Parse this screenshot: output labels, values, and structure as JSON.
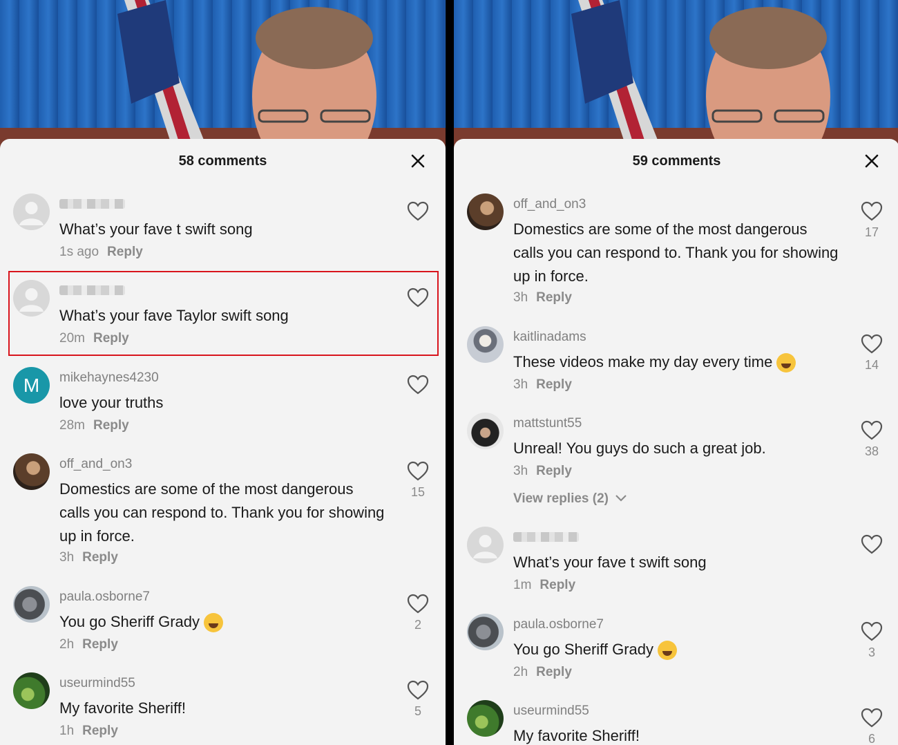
{
  "left": {
    "title": "58 comments",
    "comments": [
      {
        "username": "",
        "text": "What’s your fave t swift song",
        "time": "1s ago",
        "reply": "Reply",
        "likes": ""
      },
      {
        "username": "",
        "text": "What’s your fave Taylor swift song",
        "time": "20m",
        "reply": "Reply",
        "likes": ""
      },
      {
        "username": "mikehaynes4230",
        "avatar_letter": "M",
        "text": "love your truths",
        "time": "28m",
        "reply": "Reply",
        "likes": ""
      },
      {
        "username": "off_and_on3",
        "text": "Domestics are some of the most dangerous calls you can respond to. Thank you for showing up in force.",
        "time": "3h",
        "reply": "Reply",
        "likes": "15"
      },
      {
        "username": "paula.osborne7",
        "text": "You go Sheriff Grady",
        "emoji": "rofl-emoji",
        "time": "2h",
        "reply": "Reply",
        "likes": "2"
      },
      {
        "username": "useurmind55",
        "text": "My favorite Sheriff!",
        "time": "1h",
        "reply": "Reply",
        "likes": "5"
      }
    ]
  },
  "right": {
    "title": "59 comments",
    "comments": [
      {
        "username": "off_and_on3",
        "text": "Domestics are some of the most dangerous calls you can respond to. Thank you for showing up in force.",
        "time": "3h",
        "reply": "Reply",
        "likes": "17"
      },
      {
        "username": "kaitlinadams",
        "text": "These videos make my day every time",
        "emoji": "joy-emoji",
        "time": "3h",
        "reply": "Reply",
        "likes": "14"
      },
      {
        "username": "mattstunt55",
        "text": "Unreal! You guys do such a great job.",
        "time": "3h",
        "reply": "Reply",
        "likes": "38",
        "view_replies": "View replies (2)"
      },
      {
        "username": "",
        "text": "What’s your fave t swift song",
        "time": "1m",
        "reply": "Reply",
        "likes": ""
      },
      {
        "username": "paula.osborne7",
        "text": "You go Sheriff Grady",
        "emoji": "rofl-emoji",
        "time": "2h",
        "reply": "Reply",
        "likes": "3"
      },
      {
        "username": "useurmind55",
        "text": "My favorite Sheriff!",
        "time": "",
        "reply": "",
        "likes": "6"
      }
    ]
  },
  "colors": {
    "sheet_bg": "#f3f3f3",
    "highlight": "#d8141c",
    "avatar_letter_bg": "#1997a8"
  },
  "icons": {
    "close": "close-icon",
    "like": "heart-outline-icon",
    "chevron": "chevron-down-icon"
  }
}
